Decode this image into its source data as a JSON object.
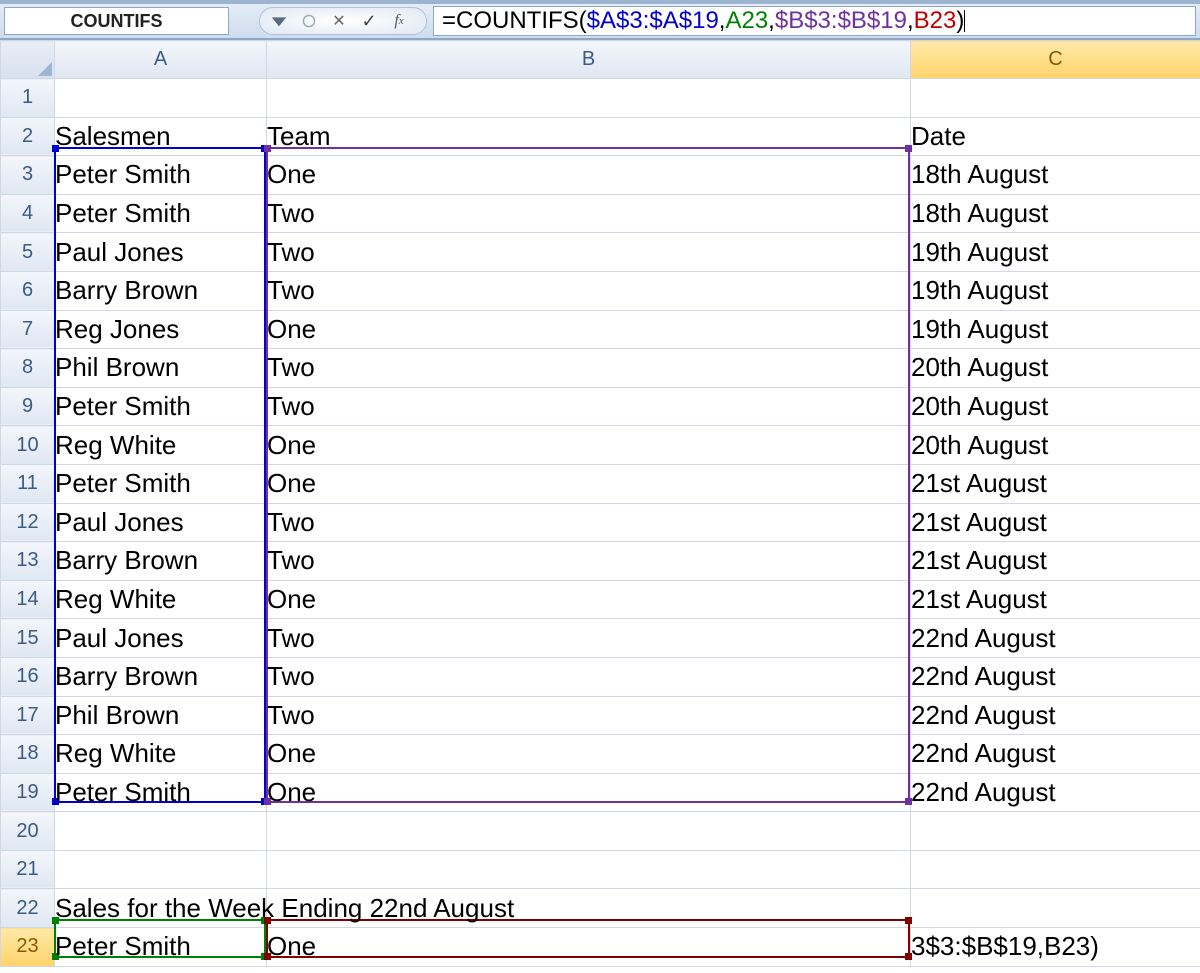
{
  "nameBox": "COUNTIFS",
  "formula": {
    "prefix": "=COUNTIFS(",
    "arg1": "$A$3:$A$19",
    "sep1": ",",
    "arg2": "A23",
    "sep2": ",",
    "arg3": "$B$3:$B$19",
    "sep3": ",",
    "arg4": "B23",
    "suffix": ")"
  },
  "columns": [
    "A",
    "B",
    "C"
  ],
  "headerRow": {
    "A": "Salesmen",
    "B": "Team",
    "C": "Date"
  },
  "rows": [
    {
      "n": 1,
      "A": "",
      "B": "",
      "C": ""
    },
    {
      "n": 2,
      "A": "Salesmen",
      "B": "Team",
      "C": "Date"
    },
    {
      "n": 3,
      "A": "Peter Smith",
      "B": "One",
      "C": "18th August"
    },
    {
      "n": 4,
      "A": "Peter Smith",
      "B": "Two",
      "C": "18th August"
    },
    {
      "n": 5,
      "A": "Paul Jones",
      "B": "Two",
      "C": "19th August"
    },
    {
      "n": 6,
      "A": "Barry Brown",
      "B": "Two",
      "C": "19th August"
    },
    {
      "n": 7,
      "A": "Reg Jones",
      "B": "One",
      "C": "19th August"
    },
    {
      "n": 8,
      "A": "Phil Brown",
      "B": "Two",
      "C": "20th August"
    },
    {
      "n": 9,
      "A": "Peter Smith",
      "B": "Two",
      "C": "20th August"
    },
    {
      "n": 10,
      "A": "Reg White",
      "B": "One",
      "C": "20th August"
    },
    {
      "n": 11,
      "A": "Peter Smith",
      "B": "One",
      "C": "21st August"
    },
    {
      "n": 12,
      "A": "Paul Jones",
      "B": "Two",
      "C": "21st August"
    },
    {
      "n": 13,
      "A": "Barry Brown",
      "B": "Two",
      "C": "21st August"
    },
    {
      "n": 14,
      "A": "Reg White",
      "B": "One",
      "C": "21st August"
    },
    {
      "n": 15,
      "A": "Paul Jones",
      "B": "Two",
      "C": "22nd August"
    },
    {
      "n": 16,
      "A": "Barry Brown",
      "B": "Two",
      "C": "22nd August"
    },
    {
      "n": 17,
      "A": "Phil Brown",
      "B": "Two",
      "C": "22nd August"
    },
    {
      "n": 18,
      "A": "Reg White",
      "B": "One",
      "C": "22nd August"
    },
    {
      "n": 19,
      "A": "Peter Smith",
      "B": "One",
      "C": "22nd August"
    },
    {
      "n": 20,
      "A": "",
      "B": "",
      "C": ""
    },
    {
      "n": 21,
      "A": "",
      "B": "",
      "C": ""
    },
    {
      "n": 22,
      "A": "Sales for the Week Ending 22nd August",
      "B": "",
      "C": ""
    },
    {
      "n": 23,
      "A": "Peter Smith",
      "B": "One",
      "C": "3$3:$B$19,B23)"
    }
  ],
  "activeCell": "C23",
  "activeRow": 23,
  "activeCol": "C",
  "layout": {
    "rowHdrW": 54,
    "colW": {
      "A": 212,
      "B": 644,
      "C": 290
    },
    "hdrH": 30,
    "rowH": 38.6
  },
  "ranges": {
    "blue": {
      "c1": "A",
      "r1": 3,
      "c2": "A",
      "r2": 19
    },
    "purple": {
      "c1": "B",
      "r1": 3,
      "c2": "B",
      "r2": 19
    },
    "green": {
      "c1": "A",
      "r1": 23,
      "c2": "A",
      "r2": 23
    },
    "red": {
      "c1": "B",
      "r1": 23,
      "c2": "B",
      "r2": 23
    }
  }
}
